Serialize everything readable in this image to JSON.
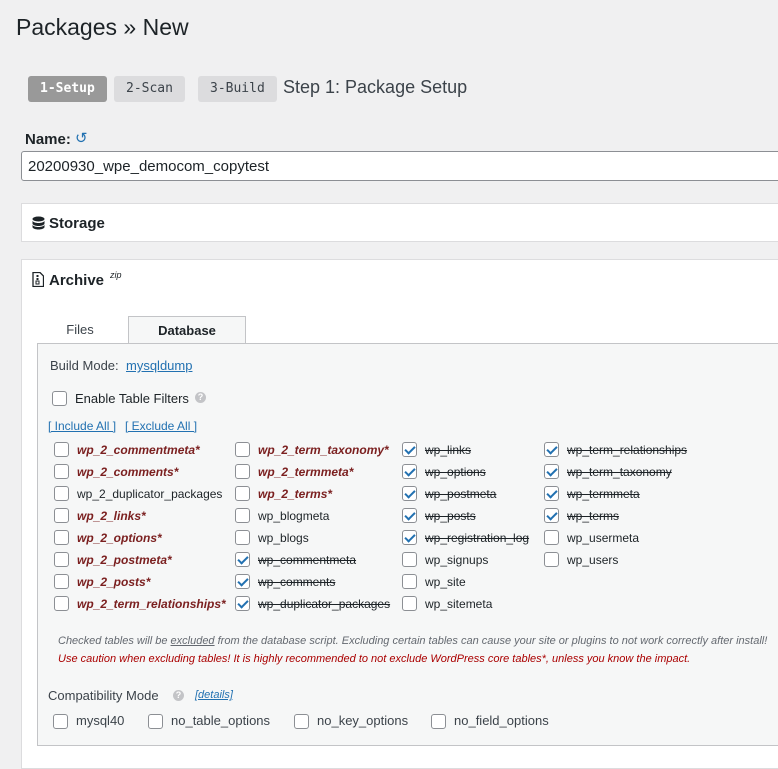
{
  "page": {
    "title": "Packages » New"
  },
  "steps": [
    {
      "label": "1-Setup"
    },
    {
      "label": "2-Scan"
    },
    {
      "label": "3-Build"
    }
  ],
  "step_title": "Step 1: Package Setup",
  "name_section": {
    "label": "Name:",
    "value": "20200930_wpe_democom_copytest"
  },
  "storage": {
    "title": "Storage"
  },
  "archive": {
    "title": "Archive",
    "suffix": "zip",
    "tabs": [
      {
        "label": "Files"
      },
      {
        "label": "Database"
      }
    ],
    "build_mode_label": "Build Mode:",
    "build_mode_value": "mysqldump",
    "enable_filters_label": "Enable Table Filters",
    "include_all": "[ Include All ]",
    "exclude_all": "[ Exclude All ]",
    "tables": [
      [
        {
          "name": "wp_2_commentmeta*",
          "core": true,
          "checked": false
        },
        {
          "name": "wp_2_comments*",
          "core": true,
          "checked": false
        },
        {
          "name": "wp_2_duplicator_packages",
          "core": false,
          "checked": false
        },
        {
          "name": "wp_2_links*",
          "core": true,
          "checked": false
        },
        {
          "name": "wp_2_options*",
          "core": true,
          "checked": false
        },
        {
          "name": "wp_2_postmeta*",
          "core": true,
          "checked": false
        },
        {
          "name": "wp_2_posts*",
          "core": true,
          "checked": false
        },
        {
          "name": "wp_2_term_relationships*",
          "core": true,
          "checked": false
        }
      ],
      [
        {
          "name": "wp_2_term_taxonomy*",
          "core": true,
          "checked": false
        },
        {
          "name": "wp_2_termmeta*",
          "core": true,
          "checked": false
        },
        {
          "name": "wp_2_terms*",
          "core": true,
          "checked": false
        },
        {
          "name": "wp_blogmeta",
          "core": false,
          "checked": false
        },
        {
          "name": "wp_blogs",
          "core": false,
          "checked": false
        },
        {
          "name": "wp_commentmeta",
          "core": false,
          "checked": true
        },
        {
          "name": "wp_comments",
          "core": false,
          "checked": true
        },
        {
          "name": "wp_duplicator_packages",
          "core": false,
          "checked": true
        }
      ],
      [
        {
          "name": "wp_links",
          "core": false,
          "checked": true
        },
        {
          "name": "wp_options",
          "core": false,
          "checked": true
        },
        {
          "name": "wp_postmeta",
          "core": false,
          "checked": true
        },
        {
          "name": "wp_posts",
          "core": false,
          "checked": true
        },
        {
          "name": "wp_registration_log",
          "core": false,
          "checked": true
        },
        {
          "name": "wp_signups",
          "core": false,
          "checked": false
        },
        {
          "name": "wp_site",
          "core": false,
          "checked": false
        },
        {
          "name": "wp_sitemeta",
          "core": false,
          "checked": false
        }
      ],
      [
        {
          "name": "wp_term_relationships",
          "core": false,
          "checked": true
        },
        {
          "name": "wp_term_taxonomy",
          "core": false,
          "checked": true
        },
        {
          "name": "wp_termmeta",
          "core": false,
          "checked": true
        },
        {
          "name": "wp_terms",
          "core": false,
          "checked": true
        },
        {
          "name": "wp_usermeta",
          "core": false,
          "checked": false
        },
        {
          "name": "wp_users",
          "core": false,
          "checked": false
        }
      ]
    ],
    "note1_pre": "Checked tables will be ",
    "note1_em": "excluded",
    "note1_post": " from the database script. Excluding certain tables can cause your site or plugins to not work correctly after install!",
    "note2": "Use caution when excluding tables! It is highly recommended to not exclude WordPress core tables*, unless you know the impact.",
    "compat_label": "Compatibility Mode",
    "compat_details": "[details]",
    "compat_options": [
      {
        "label": "mysql40"
      },
      {
        "label": "no_table_options"
      },
      {
        "label": "no_key_options"
      },
      {
        "label": "no_field_options"
      }
    ]
  },
  "colors": {
    "link": "#2271b1",
    "core_table": "#7b2020",
    "warning": "#aa0000"
  }
}
